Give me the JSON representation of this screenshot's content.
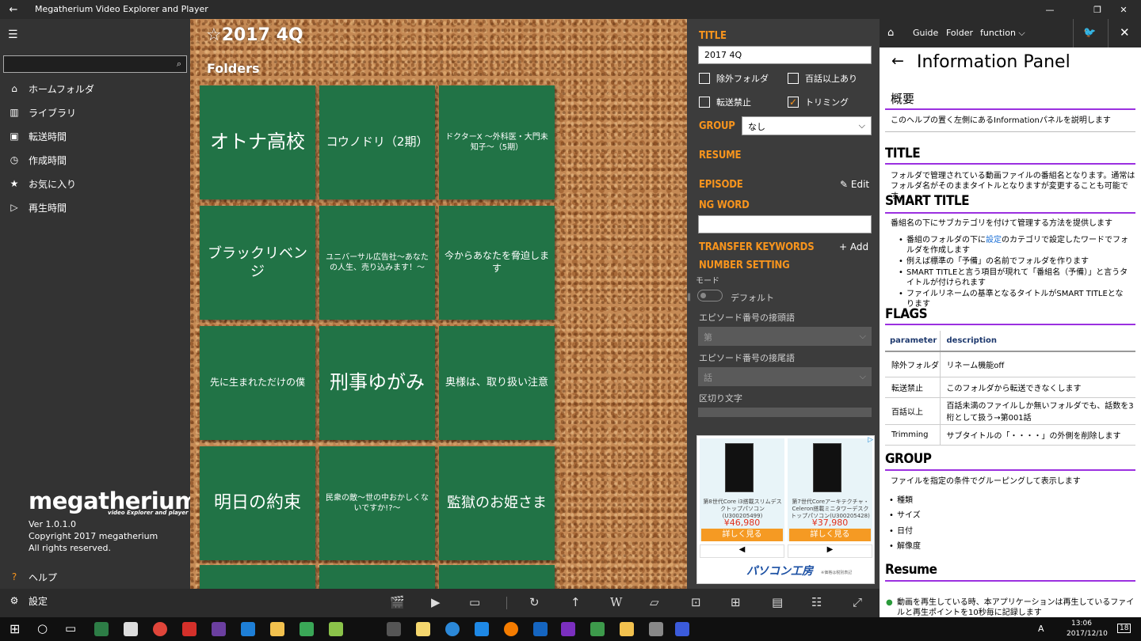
{
  "window": {
    "title": "Megatherium Video Explorer and Player",
    "back": "←",
    "min": "—",
    "max": "❐",
    "close": "✕"
  },
  "sidebar": {
    "menu_icon": "hamburger-icon",
    "search_placeholder": "",
    "items": [
      {
        "label": "ホームフォルダ",
        "icon": "home-icon",
        "glyph": "⌂"
      },
      {
        "label": "ライブラリ",
        "icon": "library-icon",
        "glyph": "▥"
      },
      {
        "label": "転送時間",
        "icon": "calendar-icon",
        "glyph": "▣"
      },
      {
        "label": "作成時間",
        "icon": "clock-icon",
        "glyph": "◷"
      },
      {
        "label": "お気に入り",
        "icon": "star-icon",
        "glyph": "★"
      },
      {
        "label": "再生時間",
        "icon": "play-icon",
        "glyph": "▷"
      }
    ],
    "logo": "megatherium",
    "logo_sub": "video Explorer and player",
    "version": "Ver 1.0.1.0",
    "copyright": "Copyright 2017 megatherium",
    "rights": "All rights reserved.",
    "help": "ヘルプ",
    "settings": "設定",
    "help_glyph": "?",
    "settings_glyph": "⚙"
  },
  "main": {
    "title": "☆2017 4Q",
    "folders_label": "Folders",
    "tiles": [
      {
        "label": "オトナ高校",
        "size": "big"
      },
      {
        "label": "コウノドリ（2期）",
        "size": "mid"
      },
      {
        "label": "ドクターX ～外科医・大門未知子～（5期）",
        "size": "small"
      },
      {
        "label": "ブラックリベンジ",
        "size": "mid2"
      },
      {
        "label": "ユニバーサル広告社～あなたの人生、売り込みます！～",
        "size": "small"
      },
      {
        "label": "今からあなたを脅迫します",
        "size": "sm2"
      },
      {
        "label": "先に生まれただけの僕",
        "size": "sm2"
      },
      {
        "label": "刑事ゆがみ",
        "size": "big"
      },
      {
        "label": "奥様は、取り扱い注意",
        "size": "sm3"
      },
      {
        "label": "明日の約束",
        "size": "big2"
      },
      {
        "label": "民衆の敵～世の中おかしくないですか!?～",
        "size": "small"
      },
      {
        "label": "監獄のお姫さま",
        "size": "mid2"
      }
    ]
  },
  "detail": {
    "title_label": "TITLE",
    "title_value": "2017 4Q",
    "checks": [
      {
        "label": "除外フォルダ",
        "checked": false
      },
      {
        "label": "百話以上あり",
        "checked": false
      },
      {
        "label": "転送禁止",
        "checked": false
      },
      {
        "label": "トリミング",
        "checked": true
      }
    ],
    "group_label": "GROUP",
    "group_value": "なし",
    "resume_label": "RESUME",
    "episode_label": "EPISODE",
    "edit": "Edit",
    "ngword_label": "NG WORD",
    "transfer_label": "TRANSFER KEYWORDS",
    "add": "Add",
    "number_label": "NUMBER SETTING",
    "mode": "モード",
    "default": "デフォルト",
    "prefix_label": "エピソード番号の接頭語",
    "prefix_value": "第",
    "suffix_label": "エピソード番号の接尾語",
    "suffix_value": "話",
    "separator_label": "区切り文字"
  },
  "ad": {
    "items": [
      {
        "text": "第8世代Core i3搭載スリムデスクトップパソコン(U300205499)",
        "price": "¥46,980",
        "button": "詳しく見る"
      },
      {
        "text": "第7世代Coreアーキテクチャ・Celeron搭載ミニタワーデスクトップパソコン(U300205428)",
        "price": "¥37,980",
        "button": "詳しく見る"
      }
    ],
    "prev": "◀",
    "next": "▶",
    "brand": "パソコン工房",
    "brand_note": "※価格は税別表記"
  },
  "info_header": {
    "home": "⌂",
    "guide": "Guide",
    "folder": "Folder",
    "function": "function ⌵",
    "twitter": "twitter-icon",
    "close": "✕"
  },
  "info": {
    "back": "←",
    "title": "Information Panel",
    "overview_h": "概要",
    "overview_p": "このヘルプの置く左側にあるInformationパネルを説明します",
    "title_h": "TITLE",
    "title_p": "フォルダで管理されている動画ファイルの番組名となります。通常はフォルダ名がそのままタイトルとなりますが変更することも可能です。",
    "smart_h": "SMART TITLE",
    "smart_p": "番組名の下にサブカテゴリを付けて管理する方法を提供します",
    "smart_b1a": "番組のフォルダの下に",
    "smart_b1link": "設定",
    "smart_b1b": "のカテゴリで設定したワードでフォルダを作成します",
    "smart_b2": "例えば標準の「予備」の名前でフォルダを作ります",
    "smart_b3": "SMART TITLEと言う項目が現れて「番組名（予備）」と言うタイトルが付けられます",
    "smart_b4": "ファイルリネームの基準となるタイトルがSMART TITLEとなります",
    "flags_h": "FLAGS",
    "flags_cols": [
      "parameter",
      "description"
    ],
    "flags_rows": [
      [
        "除外フォルダ",
        "リネーム機能off"
      ],
      [
        "転送禁止",
        "このフォルダから転送できなくします"
      ],
      [
        "百話以上",
        "百話未満のファイルしか無いフォルダでも、話数を3桁として扱う→第001話"
      ],
      [
        "Trimming",
        "サブタイトルの「・・・・」の外側を削除します"
      ]
    ],
    "group_h": "GROUP",
    "group_p": "ファイルを指定の条件でグルーピングして表示します",
    "group_items": [
      "種類",
      "サイズ",
      "日付",
      "解像度"
    ],
    "resume_h": "Resume",
    "resume_b1": "動画を再生している時、本アプリケーションは再生しているファイルと再生ポイントを10秒毎に記録します"
  },
  "toolbar": {
    "icons": [
      "clapper-icon",
      "play-step-icon",
      "monitor-icon",
      "refresh-icon",
      "up-arrow-icon",
      "w-icon",
      "image-icon",
      "shrink-icon",
      "add-window-icon",
      "clipboard-icon",
      "speaker-list-icon",
      "expand-icon"
    ],
    "glyphs": [
      "🎬",
      "▶",
      "▭",
      "↻",
      "↑",
      "W",
      "▱",
      "⊡",
      "⊞",
      "▤",
      "☷",
      "⤢"
    ]
  },
  "taskbar": {
    "start": "⊞",
    "search": "○",
    "taskview": "▭",
    "time": "13:06",
    "date": "2017/12/10",
    "ime": "A",
    "notify": "18"
  }
}
